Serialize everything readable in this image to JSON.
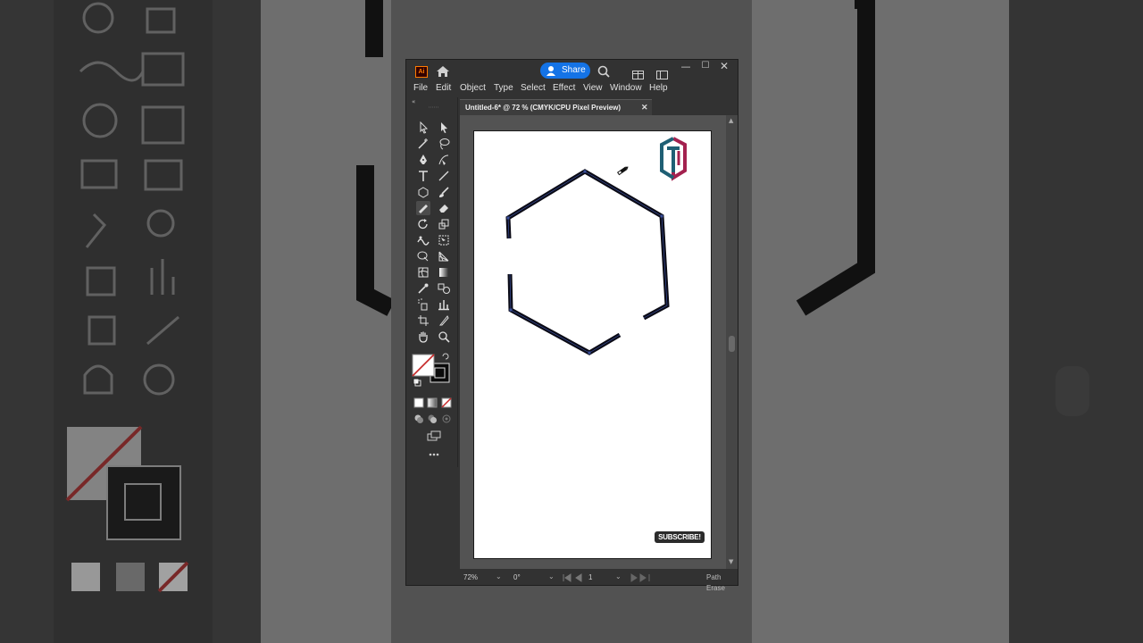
{
  "app": {
    "logo_text": "Ai",
    "share_label": "Share",
    "window_controls": {
      "minimize": "—",
      "maximize": "☐",
      "close": "✕"
    }
  },
  "menu": [
    "File",
    "Edit",
    "Object",
    "Type",
    "Select",
    "Effect",
    "View",
    "Window",
    "Help"
  ],
  "document_tab": {
    "title": "Untitled-6* @ 72 % (CMYK/CPU Pixel Preview)",
    "close": "✕"
  },
  "tools": [
    "selection-tool",
    "direct-selection-tool",
    "magic-wand-tool",
    "lasso-tool",
    "pen-tool",
    "curvature-tool",
    "type-tool",
    "line-segment-tool",
    "shape-tool",
    "paintbrush-tool",
    "shaper-tool",
    "eraser-tool",
    "rotate-tool",
    "scale-tool",
    "puppet-warp-tool",
    "free-transform-tool",
    "shape-builder-tool",
    "perspective-grid-tool",
    "mesh-tool",
    "gradient-tool",
    "eyedropper-tool",
    "blend-tool",
    "symbol-sprayer-tool",
    "column-graph-tool",
    "artboard-tool",
    "slice-tool",
    "hand-tool",
    "zoom-tool"
  ],
  "artboard": {
    "badge": "SUBSCRIBE!",
    "logo_colors": {
      "teal": "#1f5f74",
      "magenta": "#a3214f"
    }
  },
  "status_bar": {
    "zoom": "72%",
    "angle": "0°",
    "page": "1",
    "tool_name": "Path Erase"
  },
  "colors": {
    "share_blue": "#1473e6",
    "ui_dark": "#323232",
    "path_stroke": "#0b0b16"
  }
}
